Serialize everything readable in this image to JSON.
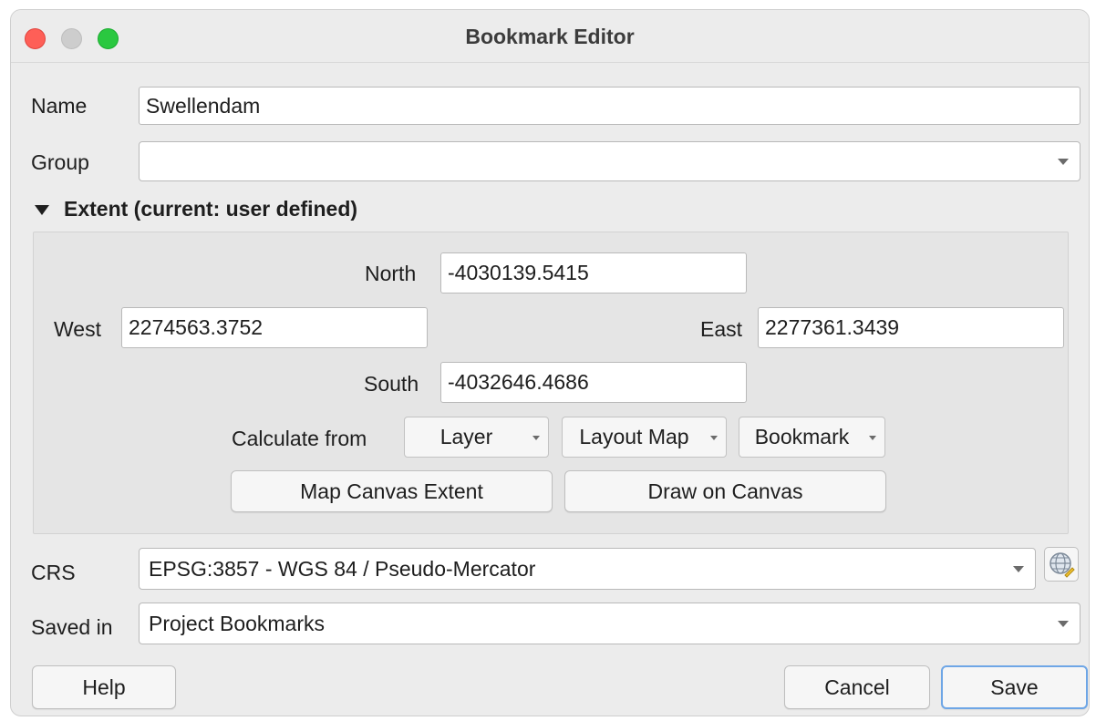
{
  "window": {
    "title": "Bookmark Editor"
  },
  "form": {
    "name_label": "Name",
    "name_value": "Swellendam",
    "group_label": "Group",
    "group_value": ""
  },
  "extent": {
    "header": "Extent (current: user defined)",
    "north_label": "North",
    "north_value": "-4030139.5415",
    "west_label": "West",
    "west_value": "2274563.3752",
    "east_label": "East",
    "east_value": "2277361.3439",
    "south_label": "South",
    "south_value": "-4032646.4686",
    "calculate_from_label": "Calculate from",
    "layer_button": "Layer",
    "layout_map_button": "Layout Map",
    "bookmark_button": "Bookmark",
    "map_canvas_extent_button": "Map Canvas Extent",
    "draw_on_canvas_button": "Draw on Canvas"
  },
  "crs": {
    "label": "CRS",
    "value": "EPSG:3857 - WGS 84 / Pseudo-Mercator",
    "selector_icon": "globe-crs-icon"
  },
  "saved_in": {
    "label": "Saved in",
    "value": "Project Bookmarks"
  },
  "buttons": {
    "help": "Help",
    "cancel": "Cancel",
    "save": "Save"
  },
  "colors": {
    "close": "#fe5f57",
    "minimize": "#cdcdcd",
    "maximize": "#2ac840",
    "default_button_border": "#6ea6e6"
  }
}
